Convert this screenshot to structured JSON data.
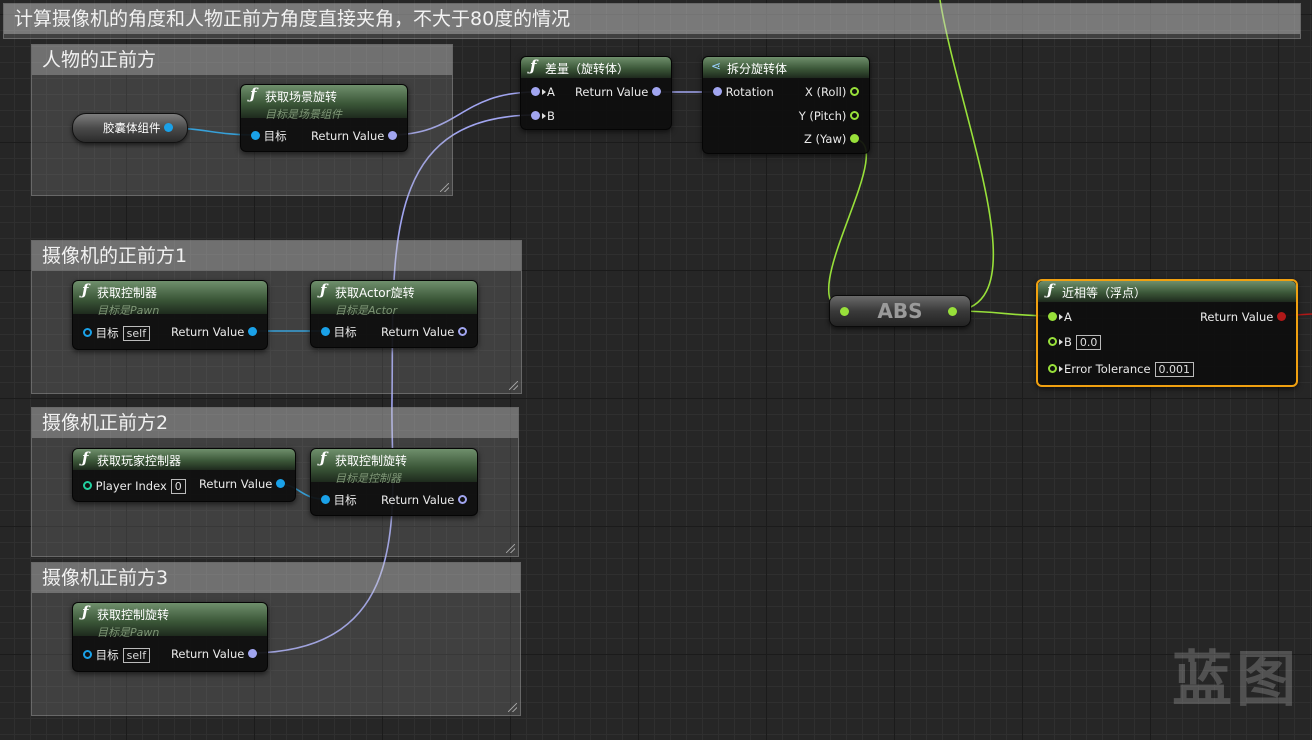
{
  "outer_comment": "计算摄像机的角度和人物正前方角度直接夹角，不大于80度的情况",
  "groups": {
    "character_forward": "人物的正前方",
    "camera_forward_1": "摄像机的正前方1",
    "camera_forward_2": "摄像机正前方2",
    "camera_forward_3": "摄像机正前方3"
  },
  "nodes": {
    "capsule": {
      "label": "胶囊体组件"
    },
    "get_scene_rotation": {
      "title": "获取场景旋转",
      "subtitle": "目标是场景组件",
      "target": "目标",
      "return": "Return Value"
    },
    "get_controller": {
      "title": "获取控制器",
      "subtitle": "目标是Pawn",
      "target": "目标",
      "self": "self",
      "return": "Return Value"
    },
    "get_actor_rotation": {
      "title": "获取Actor旋转",
      "subtitle": "目标是Actor",
      "target": "目标",
      "return": "Return Value"
    },
    "get_player_controller": {
      "title": "获取玩家控制器",
      "player_index": "Player Index",
      "index_value": "0",
      "return": "Return Value"
    },
    "get_control_rotation_a": {
      "title": "获取控制旋转",
      "subtitle": "目标是控制器",
      "target": "目标",
      "return": "Return Value"
    },
    "get_control_rotation_b": {
      "title": "获取控制旋转",
      "subtitle": "目标是Pawn",
      "target": "目标",
      "self": "self",
      "return": "Return Value"
    },
    "delta_rotator": {
      "title": "差量（旋转体）",
      "a": "A",
      "b": "B",
      "return": "Return Value"
    },
    "break_rotator": {
      "title": "拆分旋转体",
      "rotation": "Rotation",
      "x": "X (Roll)",
      "y": "Y (Pitch)",
      "z": "Z (Yaw)"
    },
    "abs": {
      "label": "ABS"
    },
    "nearly_equal": {
      "title": "近相等（浮点）",
      "a": "A",
      "b": "B",
      "b_value": "0.0",
      "tolerance": "Error Tolerance",
      "tolerance_value": "0.001",
      "return": "Return Value"
    }
  },
  "pin_colors": {
    "object": "#1aa1e8",
    "rotator": "#a1a5f0",
    "float": "#98e03a",
    "bool": "#b01818",
    "selection": "#f0a010"
  },
  "watermark": "蓝图"
}
